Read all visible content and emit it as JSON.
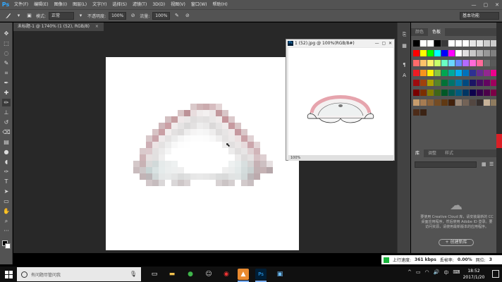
{
  "app": {
    "logo": "Ps",
    "menu": [
      "文件(F)",
      "编辑(E)",
      "图像(I)",
      "图层(L)",
      "文字(Y)",
      "选择(S)",
      "滤镜(T)",
      "3D(D)",
      "视图(V)",
      "窗口(W)",
      "帮助(H)"
    ],
    "window_controls": [
      "—",
      "▢",
      "✕"
    ]
  },
  "options": {
    "mode_label": "模式:",
    "mode_value": "正常",
    "opacity_label": "不透明度:",
    "opacity_value": "100%",
    "flow_label": "流量:",
    "flow_value": "100%",
    "workspace": "基本功能"
  },
  "document": {
    "tab_title": "未标题-1 @ 1740% (1 (52), RGB/8)",
    "tab_close": "×"
  },
  "preview_window": {
    "title": "1 (52).jpg @ 100%(RGB/8#)",
    "controls": [
      "—",
      "▢",
      "✕"
    ],
    "zoom": "100%"
  },
  "panels": {
    "tabs": [
      "颜色",
      "色板"
    ],
    "active_tab": "色板",
    "lower_tabs": [
      "库",
      "调整",
      "样式"
    ],
    "library_message": "要使用 Creative Cloud 库，请安装最新的 CC 桌面应用程序，然后使用 Adobe ID 登录。要访问资源，请使用最新版本的应用程序。",
    "library_button": "+ 创建新库",
    "swatch_colors": [
      [
        "#000000",
        "#ffffff",
        "#ffffff",
        "#000000",
        "#3a3a3a",
        "#ffffff",
        "#ffffff",
        "#ffffff",
        "#e6e6e6",
        "#e6e6e6",
        "#cccccc",
        "#cccccc"
      ],
      [
        "#ff0000",
        "#ffff00",
        "#00ff00",
        "#00ffff",
        "#0000ff",
        "#ff00ff",
        "#ffffff",
        "#e0e0e0",
        "#c8c8c8",
        "#b0b0b0",
        "#989898",
        "#808080"
      ],
      [
        "#ff6a6a",
        "#ffc36a",
        "#fff06a",
        "#c8ff6a",
        "#6affc3",
        "#6ad7ff",
        "#6a8cff",
        "#b46aff",
        "#ff6ad7",
        "#ff6a9a",
        "#707070",
        "#5a5a5a"
      ],
      [
        "#ed1c24",
        "#f7941d",
        "#fff200",
        "#8dc63f",
        "#00a651",
        "#00a99d",
        "#00aeef",
        "#0072bc",
        "#2e3192",
        "#662d91",
        "#92278f",
        "#ec008c"
      ],
      [
        "#9e0b0f",
        "#a0410d",
        "#aba000",
        "#598527",
        "#007236",
        "#00746b",
        "#0076a3",
        "#004a80",
        "#1b1464",
        "#440e62",
        "#630460",
        "#9e005d"
      ],
      [
        "#790000",
        "#7b2e00",
        "#827b00",
        "#406618",
        "#005826",
        "#005952",
        "#005b7f",
        "#003663",
        "#0d004c",
        "#32004b",
        "#4b0049",
        "#7b0046"
      ],
      [
        "#c69c6d",
        "#a67c52",
        "#8c6239",
        "#754c24",
        "#603913",
        "#42210b",
        "#998675",
        "#736357",
        "#534741",
        "#362f2d",
        "#c7b299",
        "#8e7b5f"
      ],
      [
        "#4d2c19",
        "#3b2314"
      ]
    ]
  },
  "upload": {
    "speed_label": "上行速度:",
    "speed_value": "361 kbps",
    "packet_loss_label": "丢帧率:",
    "packet_loss_value": "0.00%",
    "delay_label": "网位:",
    "delay_value": "3"
  },
  "taskbar": {
    "search_placeholder": "有问题尽管问我",
    "time": "18:52",
    "date": "2017/1/20"
  }
}
